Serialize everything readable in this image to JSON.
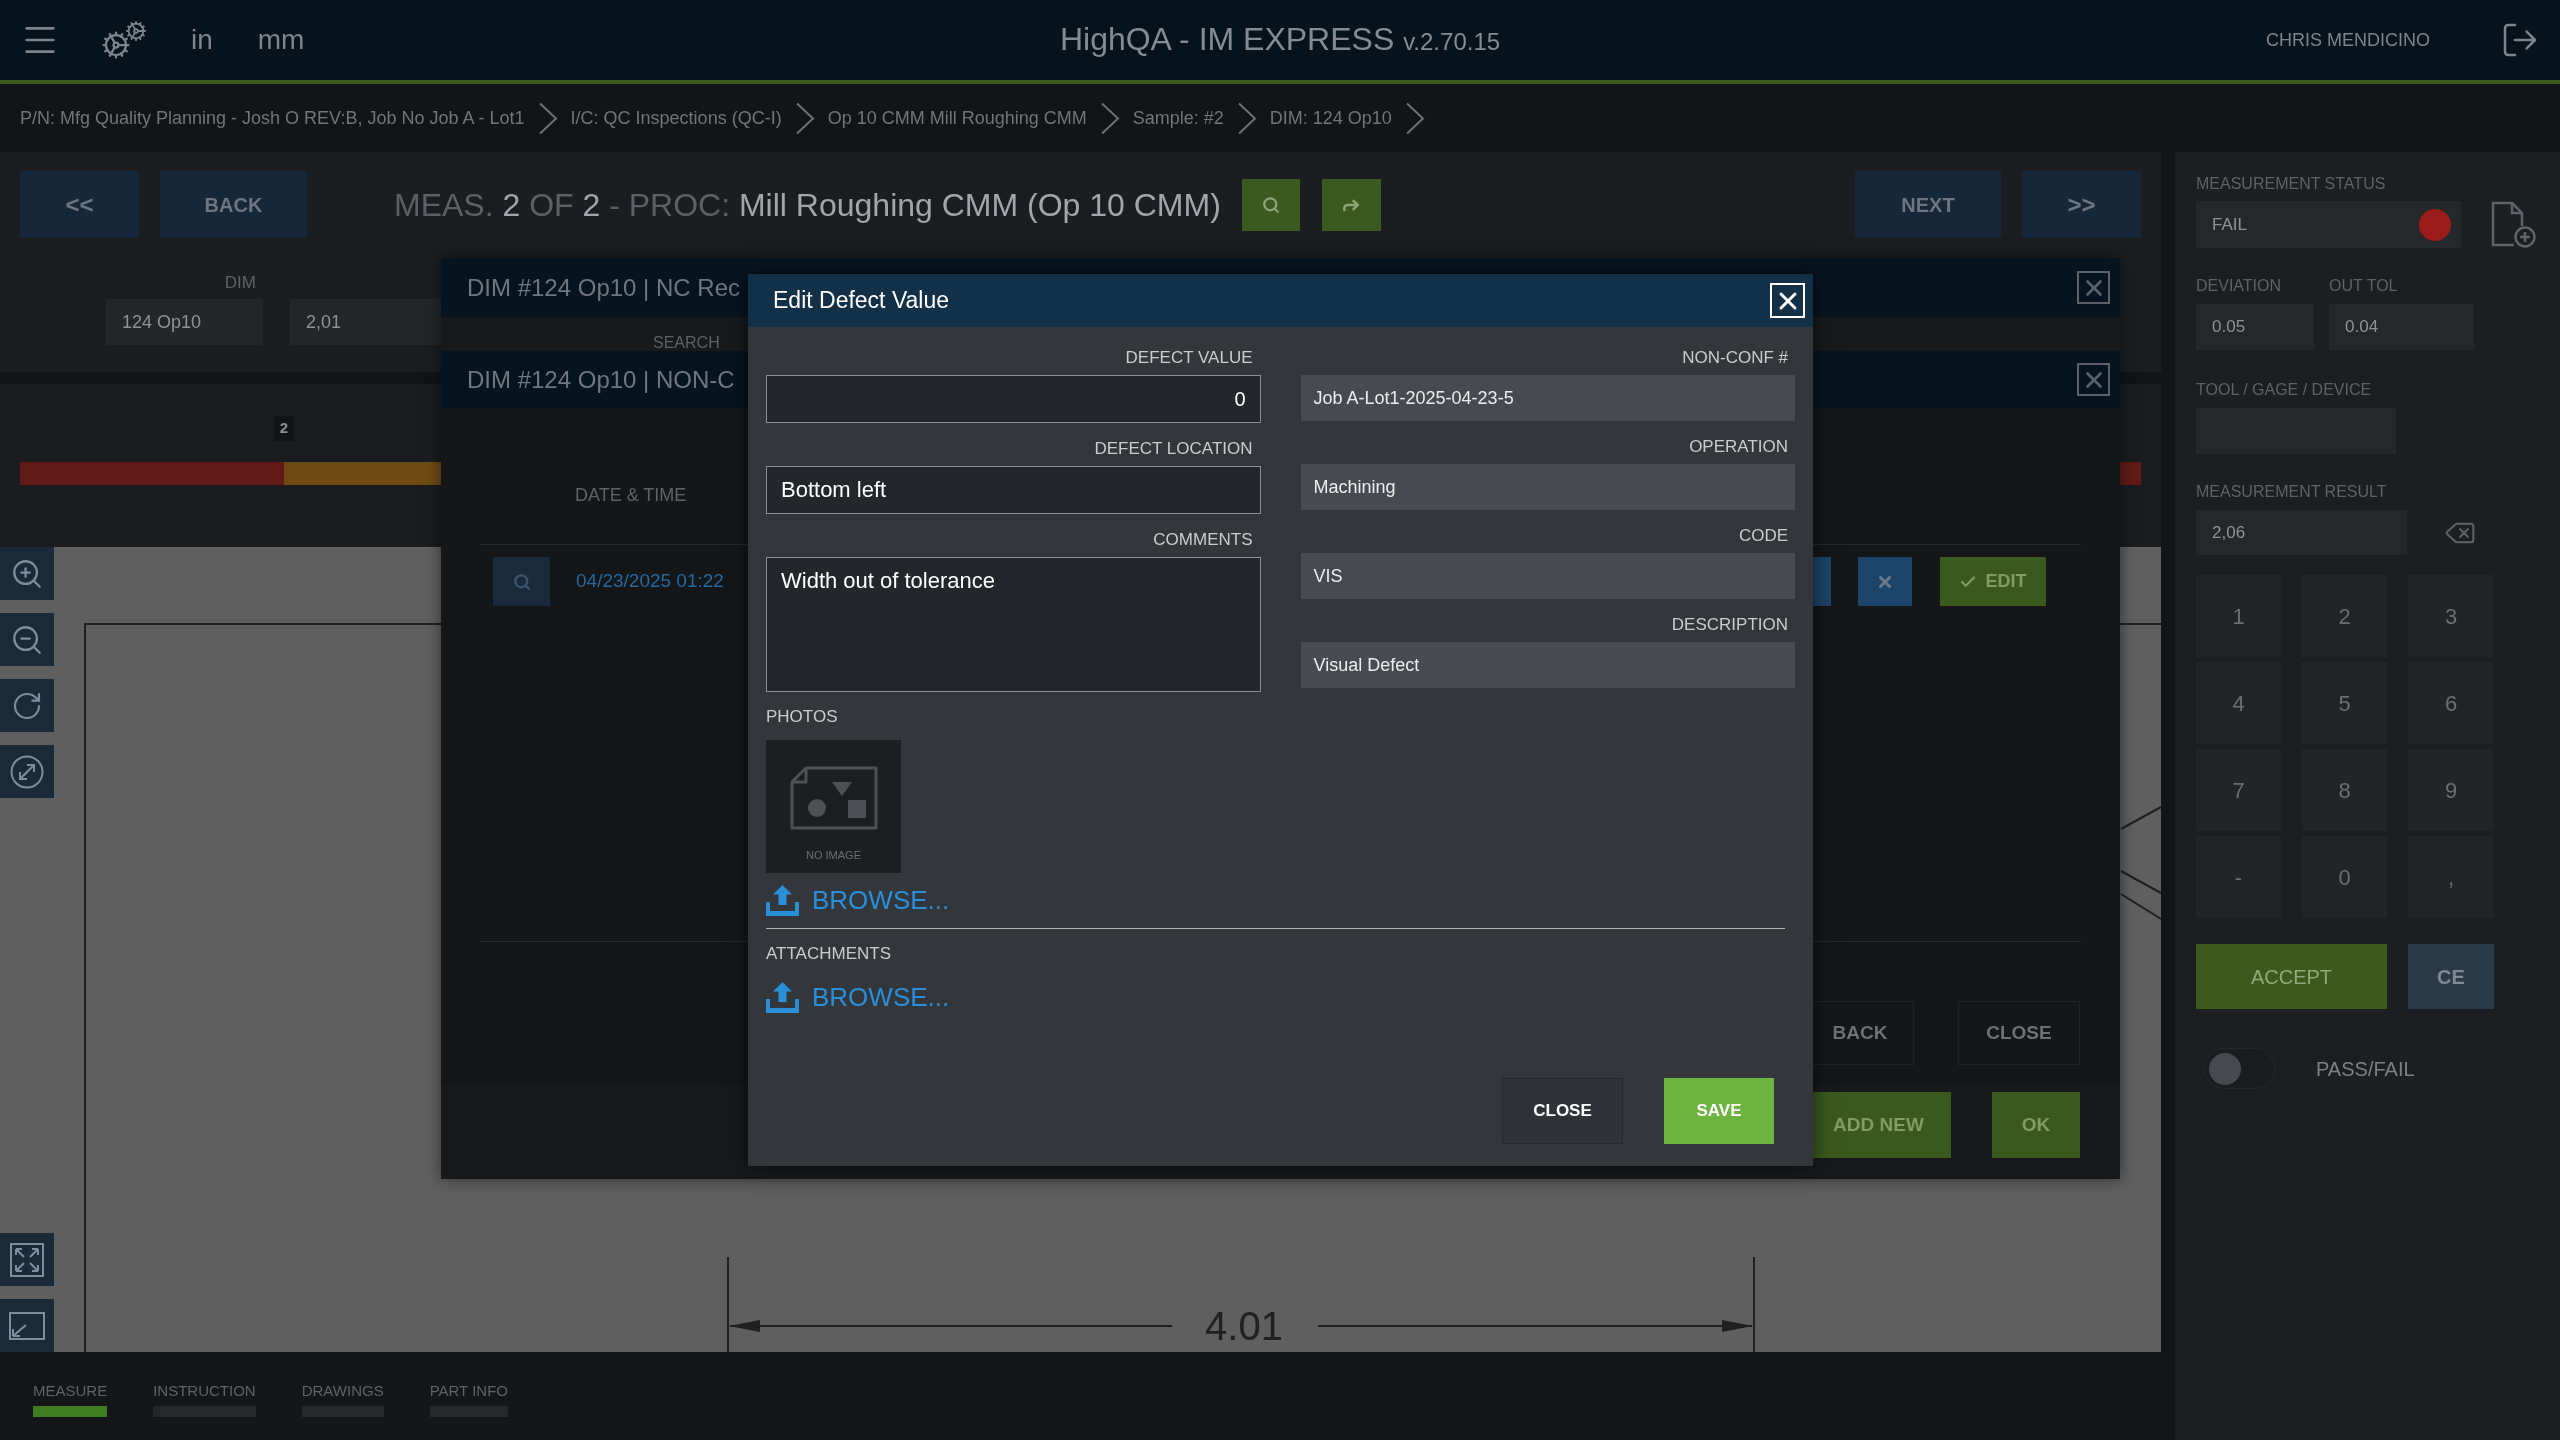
{
  "top_bar": {
    "title": "HighQA - IM EXPRESS",
    "version": "v.2.70.15",
    "units": [
      "in",
      "mm"
    ],
    "user": "CHRIS MENDICINO"
  },
  "breadcrumb": [
    "P/N: Mfg Quality Planning - Josh O REV:B, Job No Job A - Lot1",
    "I/C: QC Inspections (QC-I)",
    "Op 10 CMM Mill Roughing CMM",
    "Sample: #2",
    "DIM: 124 Op10"
  ],
  "navigation": {
    "first": "<<",
    "back": "BACK",
    "heading": [
      {
        "text": "MEAS.",
        "kind": "label"
      },
      {
        "text": "2",
        "kind": "value"
      },
      {
        "text": "OF",
        "kind": "label"
      },
      {
        "text": "2",
        "kind": "value"
      },
      {
        "text": "- PROC:",
        "kind": "label"
      },
      {
        "text": "Mill Roughing CMM (Op 10 CMM)",
        "kind": "value"
      }
    ],
    "next": "NEXT",
    "last": ">>"
  },
  "dimension": {
    "label": "DIM",
    "name": "124 Op10",
    "value": "2,01"
  },
  "tolerance_bar": {
    "marker": "2"
  },
  "drawing": {
    "dimension_value": "4.01"
  },
  "bottom_tabs": [
    {
      "label": "MEASURE",
      "selected": true
    },
    {
      "label": "INSTRUCTION",
      "selected": false
    },
    {
      "label": "DRAWINGS",
      "selected": false
    },
    {
      "label": "PART INFO",
      "selected": false
    }
  ],
  "measurement_panel": {
    "status": {
      "label": "MEASUREMENT STATUS",
      "value": "FAIL",
      "passed": false
    },
    "deviation": {
      "label": "DEVIATION",
      "value": "0.05"
    },
    "out_tol": {
      "label": "OUT TOL",
      "value": "0.04"
    },
    "tool": {
      "label": "TOOL / GAGE / DEVICE"
    },
    "result": {
      "label": "MEASUREMENT RESULT",
      "value": "2,06"
    },
    "keypad": {
      "disabled": true,
      "keys": [
        "1",
        "2",
        "3",
        "4",
        "5",
        "6",
        "7",
        "8",
        "9",
        "-",
        "0",
        ","
      ]
    },
    "accept": {
      "label": "ACCEPT",
      "disabled": true
    },
    "clear": "CE",
    "pass_fail": {
      "label": "PASS/FAIL",
      "on": false
    }
  },
  "nc_records_dialog": {
    "title": "DIM #124 Op10 | NC Rec",
    "search_label": "SEARCH",
    "buttons": [
      "ADD NEW",
      "OK"
    ]
  },
  "non_conformance_dialog": {
    "title": "DIM #124 Op10 | NON-C",
    "columns": [
      "DATE & TIME"
    ],
    "rows": [
      {
        "date_time": "04/23/2025 01:22",
        "edit": "EDIT"
      }
    ],
    "buttons": [
      "BACK",
      "CLOSE"
    ]
  },
  "edit_defect_dialog": {
    "title": "Edit Defect Value",
    "left_fields": [
      {
        "label": "DEFECT VALUE",
        "value": "0",
        "kind": "number"
      },
      {
        "label": "DEFECT LOCATION",
        "value": "Bottom left",
        "kind": "text"
      },
      {
        "label": "COMMENTS",
        "value": "Width out of tolerance",
        "kind": "textarea"
      }
    ],
    "right_fields": [
      {
        "label": "NON-CONF #",
        "value": "Job A-Lot1-2025-04-23-5",
        "kind": "readonly"
      },
      {
        "label": "OPERATION",
        "value": "Machining",
        "kind": "readonly"
      },
      {
        "label": "CODE",
        "value": "VIS",
        "kind": "readonly"
      },
      {
        "label": "DESCRIPTION",
        "value": "Visual Defect",
        "kind": "readonly"
      }
    ],
    "photos": {
      "label": "PHOTOS",
      "placeholder": "NO IMAGE",
      "browse": "BROWSE..."
    },
    "attachments": {
      "label": "ATTACHMENTS",
      "browse": "BROWSE..."
    },
    "buttons": [
      {
        "label": "CLOSE",
        "kind": "secondary"
      },
      {
        "label": "SAVE",
        "kind": "primary"
      }
    ]
  }
}
